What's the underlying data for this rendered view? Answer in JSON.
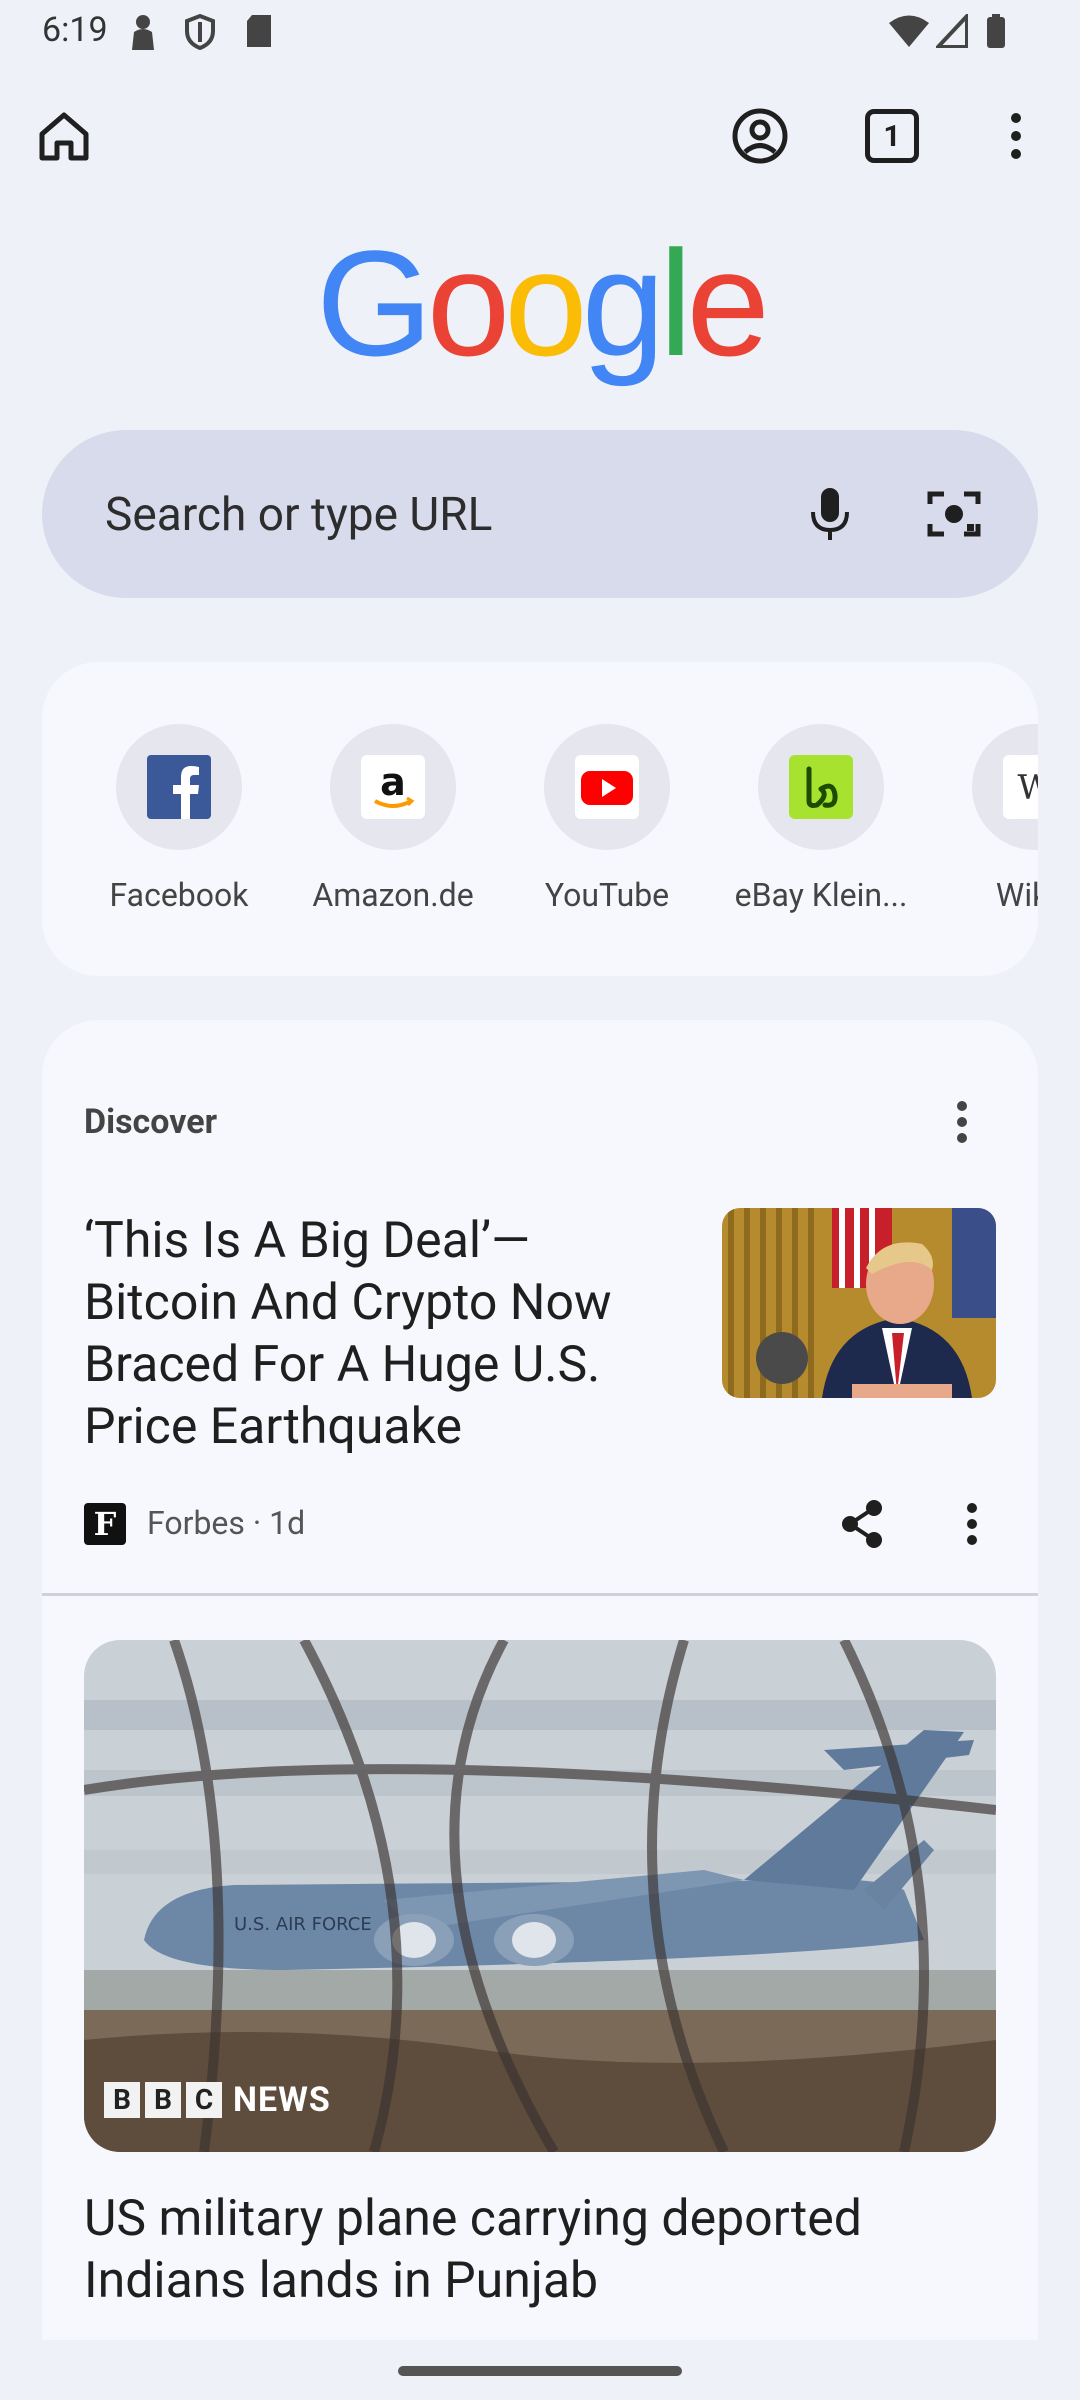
{
  "status_bar": {
    "time": "6:19"
  },
  "google_logo": {
    "letters": [
      "G",
      "o",
      "o",
      "g",
      "l",
      "e"
    ],
    "colors": [
      "#4285F4",
      "#EA4335",
      "#FBBC05",
      "#4285F4",
      "#34A853",
      "#EA4335"
    ]
  },
  "search": {
    "placeholder": "Search or type URL"
  },
  "toolbar": {
    "tab_count": "1"
  },
  "shortcuts": [
    {
      "label": "Facebook",
      "icon": "facebook-icon"
    },
    {
      "label": "Amazon.de",
      "icon": "amazon-icon"
    },
    {
      "label": "YouTube",
      "icon": "youtube-icon"
    },
    {
      "label": "eBay Klein...",
      "icon": "ebay-kleinanzeigen-icon"
    },
    {
      "label": "Wikip",
      "icon": "wikipedia-icon"
    }
  ],
  "discover": {
    "title": "Discover",
    "articles": [
      {
        "title": "‘This Is A Big Deal’—Bitcoin And Crypto Now Braced For A Huge U.S. Price Earthquake",
        "source_initial": "F",
        "source": "Forbes · 1d"
      },
      {
        "title": "US military plane carrying deported Indians lands in Punjab",
        "image_badge": {
          "letters": [
            "B",
            "B",
            "C"
          ],
          "word": "NEWS"
        },
        "plane_text": "U.S. AIR FORCE"
      }
    ]
  },
  "colors": {
    "background": "#eff1f8",
    "card": "#f7f8fd",
    "search_bg": "#d8dbeb"
  }
}
